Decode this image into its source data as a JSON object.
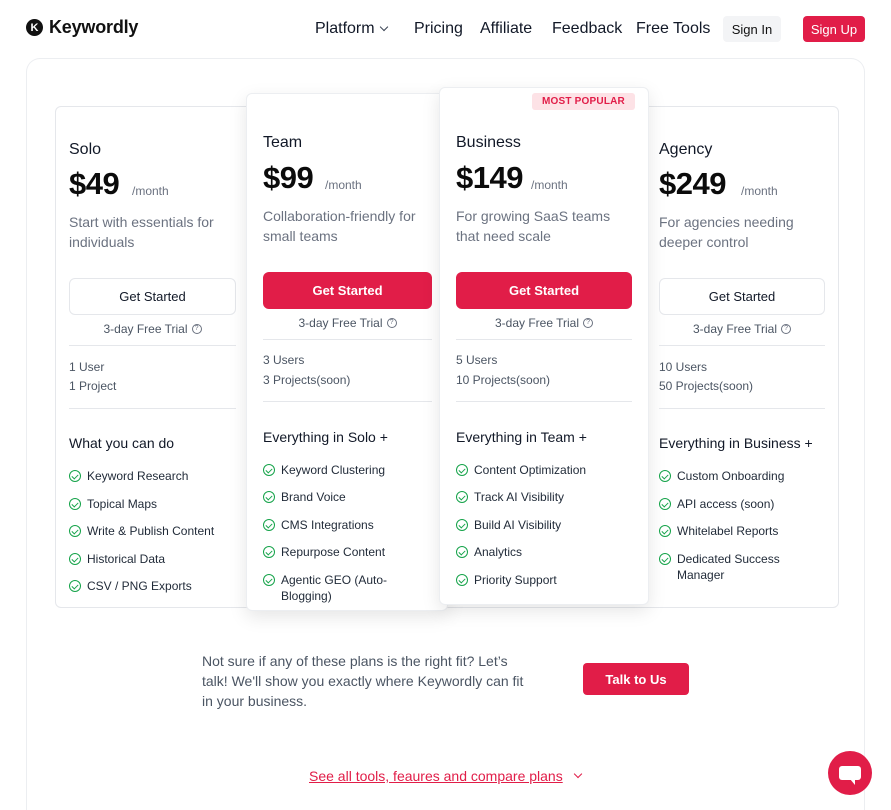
{
  "brand": {
    "logo_letter": "K",
    "name": "Keywordly"
  },
  "nav": {
    "platform": "Platform",
    "pricing": "Pricing",
    "affiliate": "Affiliate",
    "feedback": "Feedback",
    "free_tools": "Free Tools",
    "sign_in": "Sign In",
    "sign_up": "Sign Up"
  },
  "badge": "MOST POPULAR",
  "plans": [
    {
      "name": "Solo",
      "price": "$49",
      "per": "/month",
      "desc": "Start with essentials for individuals",
      "cta": "Get Started",
      "trial": "3-day Free Trial",
      "meta": [
        "1 User",
        "1 Project"
      ],
      "features_title": "What you can do",
      "features": [
        "Keyword Research",
        "Topical Maps",
        "Write & Publish Content",
        "Historical Data",
        "CSV / PNG Exports"
      ]
    },
    {
      "name": "Team",
      "price": "$99",
      "per": "/month",
      "desc": "Collaboration-friendly for small teams",
      "cta": "Get Started",
      "trial": "3-day Free Trial",
      "meta": [
        "3 Users",
        "3 Projects(soon)"
      ],
      "features_title": "Everything in Solo +",
      "features": [
        "Keyword Clustering",
        "Brand Voice",
        "CMS Integrations",
        "Repurpose Content",
        "Agentic GEO (Auto-Blogging)"
      ]
    },
    {
      "name": "Business",
      "price": "$149",
      "per": "/month",
      "desc": "For growing SaaS teams that need scale",
      "cta": "Get Started",
      "trial": "3-day Free Trial",
      "meta": [
        "5 Users",
        "10 Projects(soon)"
      ],
      "features_title": "Everything in Team +",
      "features": [
        "Content Optimization",
        "Track AI Visibility",
        "Build AI Visibility",
        "Analytics",
        "Priority Support"
      ]
    },
    {
      "name": "Agency",
      "price": "$249",
      "per": "/month",
      "desc": "For agencies needing deeper control",
      "cta": "Get Started",
      "trial": "3-day Free Trial",
      "meta": [
        "10 Users",
        "50 Projects(soon)"
      ],
      "features_title": "Everything in Business +",
      "features": [
        "Custom Onboarding",
        "API access (soon)",
        "Whitelabel Reports",
        "Dedicated Success Manager"
      ]
    }
  ],
  "cta": {
    "text": "Not sure if any of these plans is the right fit? Let’s talk! We'll show you exactly where Keywordly can fit in your business.",
    "button": "Talk to Us",
    "see_all": "See all tools, feaures and compare plans"
  }
}
